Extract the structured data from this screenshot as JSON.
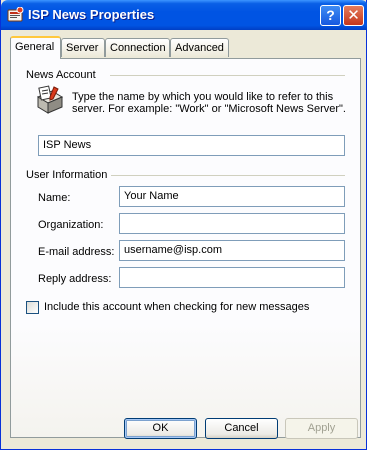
{
  "window": {
    "title": "ISP News Properties",
    "help_button": "?",
    "close_button": "✕"
  },
  "tabs": [
    "General",
    "Server",
    "Connection",
    "Advanced"
  ],
  "news_account": {
    "group_label": "News Account",
    "description": "Type the name by which you would like to refer to this server.  For example: \"Work\" or \"Microsoft News Server\".",
    "account_name": "ISP News"
  },
  "user_information": {
    "group_label": "User Information",
    "name_label": "Name:",
    "name_value": "Your Name",
    "organization_label": "Organization:",
    "organization_value": "",
    "email_label": "E-mail address:",
    "email_value": "username@isp.com",
    "reply_label": "Reply address:",
    "reply_value": ""
  },
  "include_checkbox": {
    "label": "Include this account when checking for new messages",
    "checked": false
  },
  "buttons": {
    "ok": "OK",
    "cancel": "Cancel",
    "apply": "Apply"
  },
  "colors": {
    "titlebar": "#0054e3",
    "dialog_bg": "#ece9d8",
    "active_tab_accent": "#ffc83c",
    "field_border": "#7f9db9"
  }
}
